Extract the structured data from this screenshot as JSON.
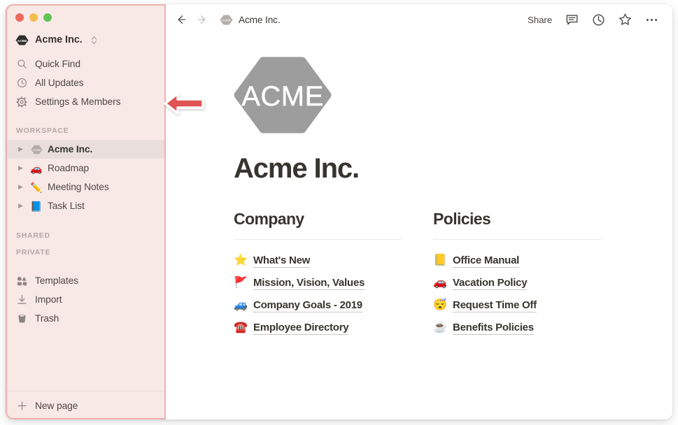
{
  "window": {
    "traffic_lights": [
      {
        "name": "close",
        "color": "#ED6A5E"
      },
      {
        "name": "minimize",
        "color": "#F4BE4F"
      },
      {
        "name": "maximize",
        "color": "#61C454"
      }
    ]
  },
  "sidebar": {
    "workspace_switcher": {
      "label": "Acme Inc.",
      "badge_text": "ACME",
      "badge_icon": "acme-hexagon-logo",
      "chevron_icon": "chevron-up-down-icon"
    },
    "nav": [
      {
        "label": "Quick Find",
        "icon": "search-icon"
      },
      {
        "label": "All Updates",
        "icon": "clock-icon"
      },
      {
        "label": "Settings & Members",
        "icon": "gear-icon"
      }
    ],
    "sections": {
      "workspace_label": "WORKSPACE",
      "shared_label": "SHARED",
      "private_label": "PRIVATE"
    },
    "workspace_pages": [
      {
        "label": "Acme Inc.",
        "emoji": "",
        "icon": "acme-hexagon-logo",
        "selected": true
      },
      {
        "label": "Roadmap",
        "emoji": "🚗",
        "icon": "car-emoji",
        "selected": false
      },
      {
        "label": "Meeting Notes",
        "emoji": "✏️",
        "icon": "pencil-emoji",
        "selected": false
      },
      {
        "label": "Task List",
        "emoji": "📘",
        "icon": "blue-book-emoji",
        "selected": false
      }
    ],
    "tools": [
      {
        "label": "Templates",
        "icon": "templates-icon"
      },
      {
        "label": "Import",
        "icon": "import-download-icon"
      },
      {
        "label": "Trash",
        "icon": "trash-icon"
      }
    ],
    "footer": {
      "label": "New page",
      "icon": "plus-icon"
    },
    "colors": {
      "background": "#F8E9E7",
      "highlight_border": "#EFAFAE",
      "selected_row": "#E9DEDC"
    }
  },
  "topbar": {
    "back_icon": "arrow-left-icon",
    "forward_icon": "arrow-right-icon",
    "breadcrumb": {
      "label": "Acme Inc.",
      "icon": "acme-hexagon-logo"
    },
    "share_label": "Share",
    "actions": [
      {
        "name": "comment-icon"
      },
      {
        "name": "clock-history-icon"
      },
      {
        "name": "star-favorite-icon"
      },
      {
        "name": "more-options-icon"
      }
    ]
  },
  "page": {
    "logo_text": "ACME",
    "logo_icon": "acme-hexagon-logo-large",
    "title": "Acme Inc.",
    "columns": [
      {
        "heading": "Company",
        "links": [
          {
            "emoji": "⭐",
            "icon": "star-emoji",
            "label": "What's New"
          },
          {
            "emoji": "🚩",
            "icon": "red-flag-emoji",
            "label": "Mission, Vision, Values"
          },
          {
            "emoji": "🚙",
            "icon": "blue-car-emoji",
            "label": "Company Goals - 2019"
          },
          {
            "emoji": "☎️",
            "icon": "telephone-emoji",
            "label": "Employee Directory"
          }
        ]
      },
      {
        "heading": "Policies",
        "links": [
          {
            "emoji": "📒",
            "icon": "ledger-emoji",
            "label": "Office Manual"
          },
          {
            "emoji": "🚗",
            "icon": "red-car-emoji",
            "label": "Vacation Policy"
          },
          {
            "emoji": "😴",
            "icon": "sleeping-face-emoji",
            "label": "Request Time Off"
          },
          {
            "emoji": "☕",
            "icon": "coffee-emoji",
            "label": "Benefits Policies"
          }
        ]
      }
    ]
  },
  "annotation": {
    "arrow_icon": "red-left-arrow-annotation",
    "color": "#E05252",
    "points_at": "Settings & Members"
  }
}
